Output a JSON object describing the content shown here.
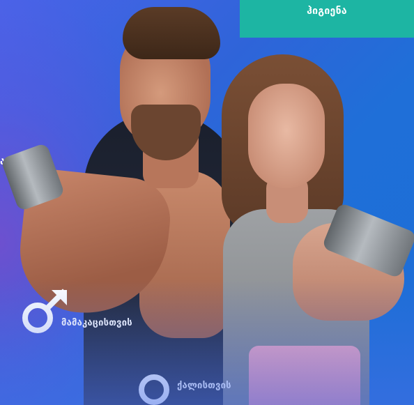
{
  "header": {
    "tab_label": "ჰიგიენა"
  },
  "edge_text": "ა",
  "categories": {
    "men_label": "მამაკაცისთვის",
    "women_label": "ქალისთვის"
  },
  "colors": {
    "tab_background": "#1db5a3",
    "background_blue": "#1f6fd8",
    "background_purple": "#8c46c8",
    "pink_product": "#f3a7bd"
  },
  "icons": {
    "men": "male-symbol-icon",
    "women": "female-symbol-icon"
  }
}
